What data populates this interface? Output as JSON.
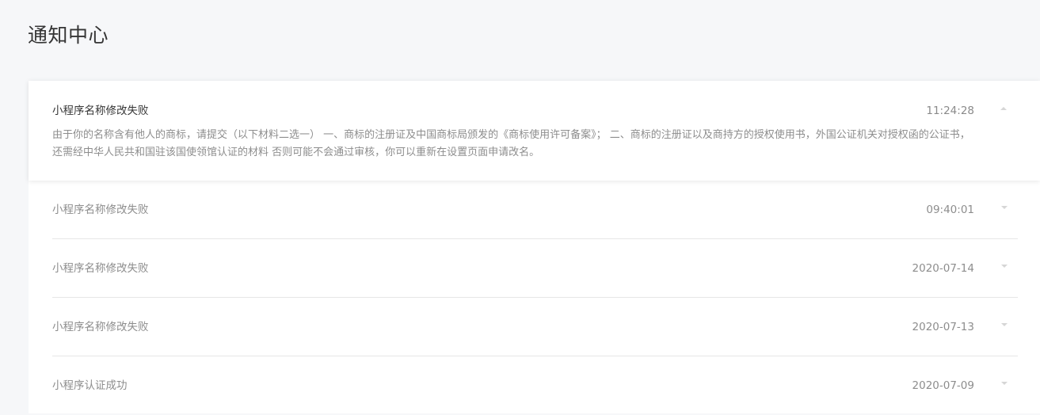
{
  "page": {
    "title": "通知中心"
  },
  "notifications": [
    {
      "title": "小程序名称修改失败",
      "time": "11:24:28",
      "expanded": true,
      "body": "由于你的名称含有他人的商标，请提交（以下材料二选一） 一、商标的注册证及中国商标局颁发的《商标使用许可备案》； 二、商标的注册证以及商持方的授权使用书，外国公证机关对授权函的公证书，还需经中华人民共和国驻该国使领馆认证的材料 否则可能不会通过审核，你可以重新在设置页面申请改名。"
    },
    {
      "title": "小程序名称修改失败",
      "time": "09:40:01",
      "expanded": false
    },
    {
      "title": "小程序名称修改失败",
      "time": "2020-07-14",
      "expanded": false
    },
    {
      "title": "小程序名称修改失败",
      "time": "2020-07-13",
      "expanded": false
    },
    {
      "title": "小程序认证成功",
      "time": "2020-07-09",
      "expanded": false
    }
  ],
  "icons": {
    "expanded_arrow": "chevron-up-icon",
    "collapsed_arrow": "chevron-down-icon"
  },
  "colors": {
    "background": "#f6f7f9",
    "card": "#ffffff",
    "title_text": "#353535",
    "muted_text": "#8d8d8d",
    "divider": "#e6e6e6"
  }
}
